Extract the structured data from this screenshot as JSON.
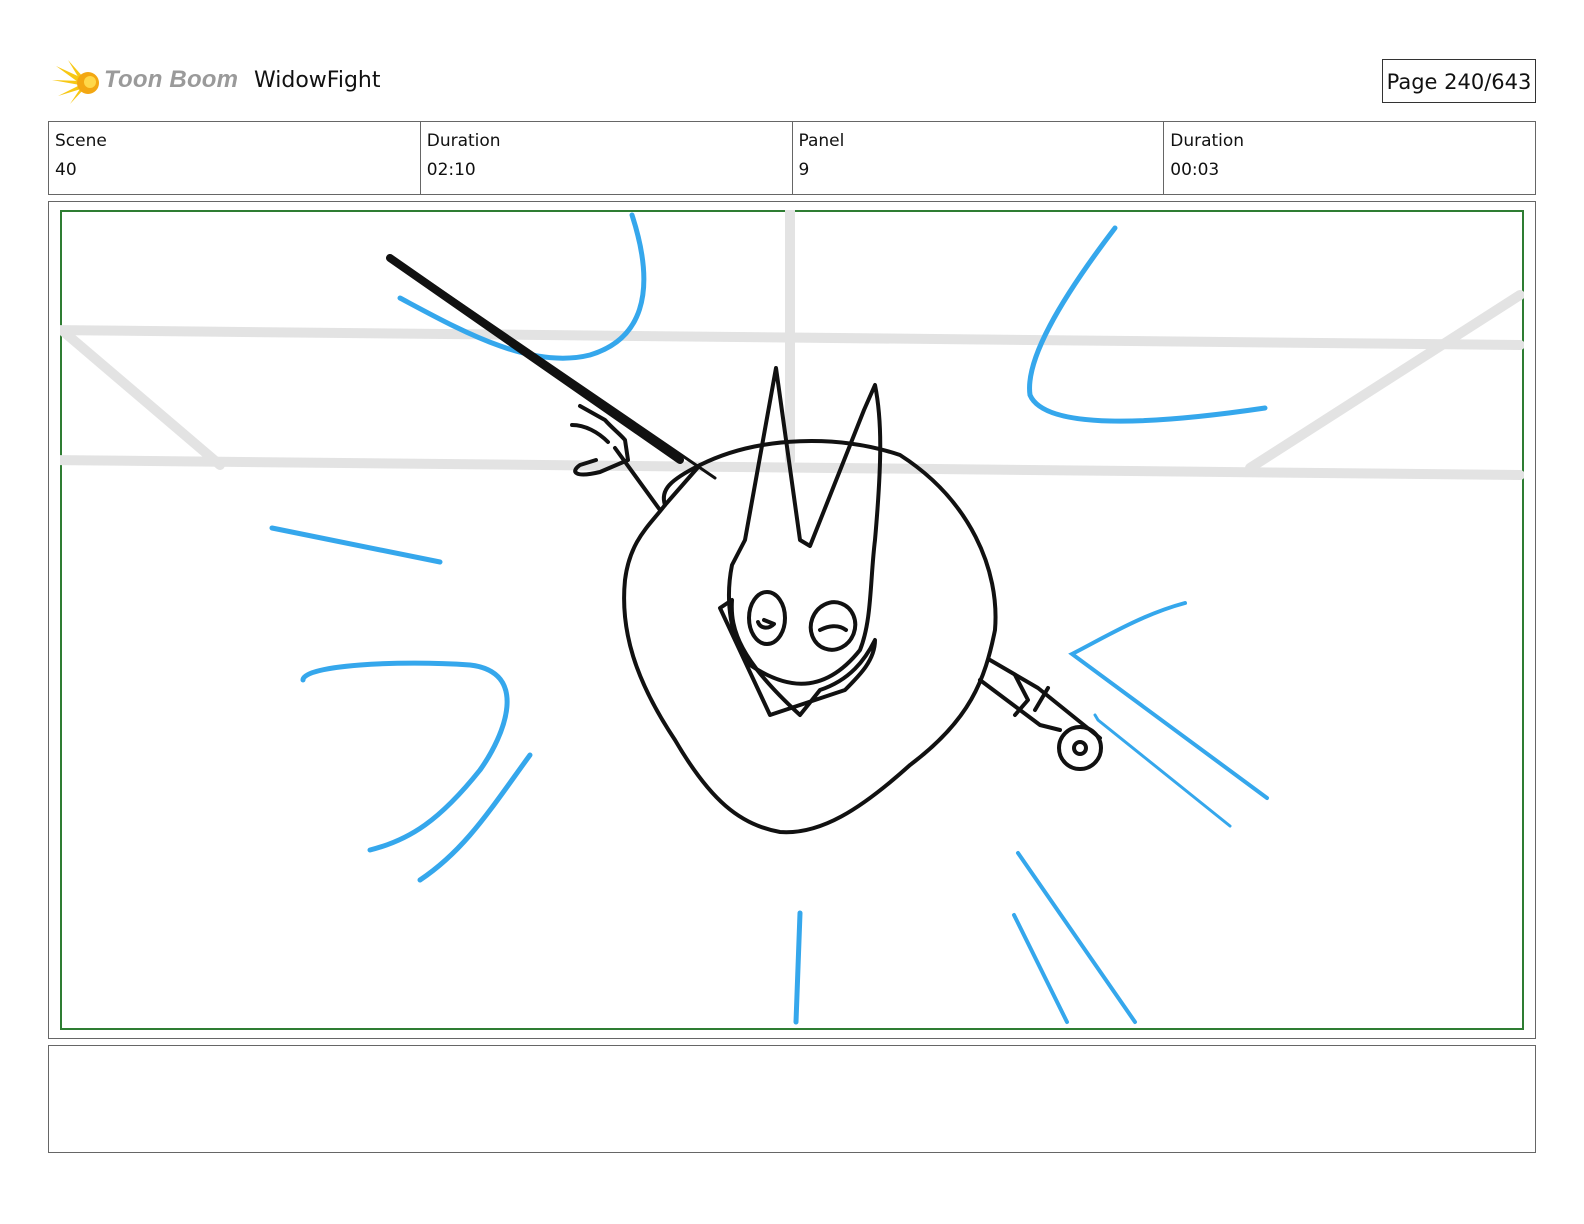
{
  "header": {
    "brand": "Toon Boom",
    "project": "WidowFight",
    "page_label": "Page 240/643",
    "logo_icon": "starburst-logo-icon"
  },
  "info": {
    "scene_label": "Scene",
    "scene_value": "40",
    "scene_duration_label": "Duration",
    "scene_duration_value": "02:10",
    "panel_label": "Panel",
    "panel_value": "9",
    "panel_duration_label": "Duration",
    "panel_duration_value": "00:03"
  },
  "panel": {
    "border_color": "#2e7d32",
    "ink_color": "#111111",
    "action_line_color": "#35a7ec",
    "bg_line_color": "#e3e3e3"
  },
  "caption": {
    "text": ""
  }
}
